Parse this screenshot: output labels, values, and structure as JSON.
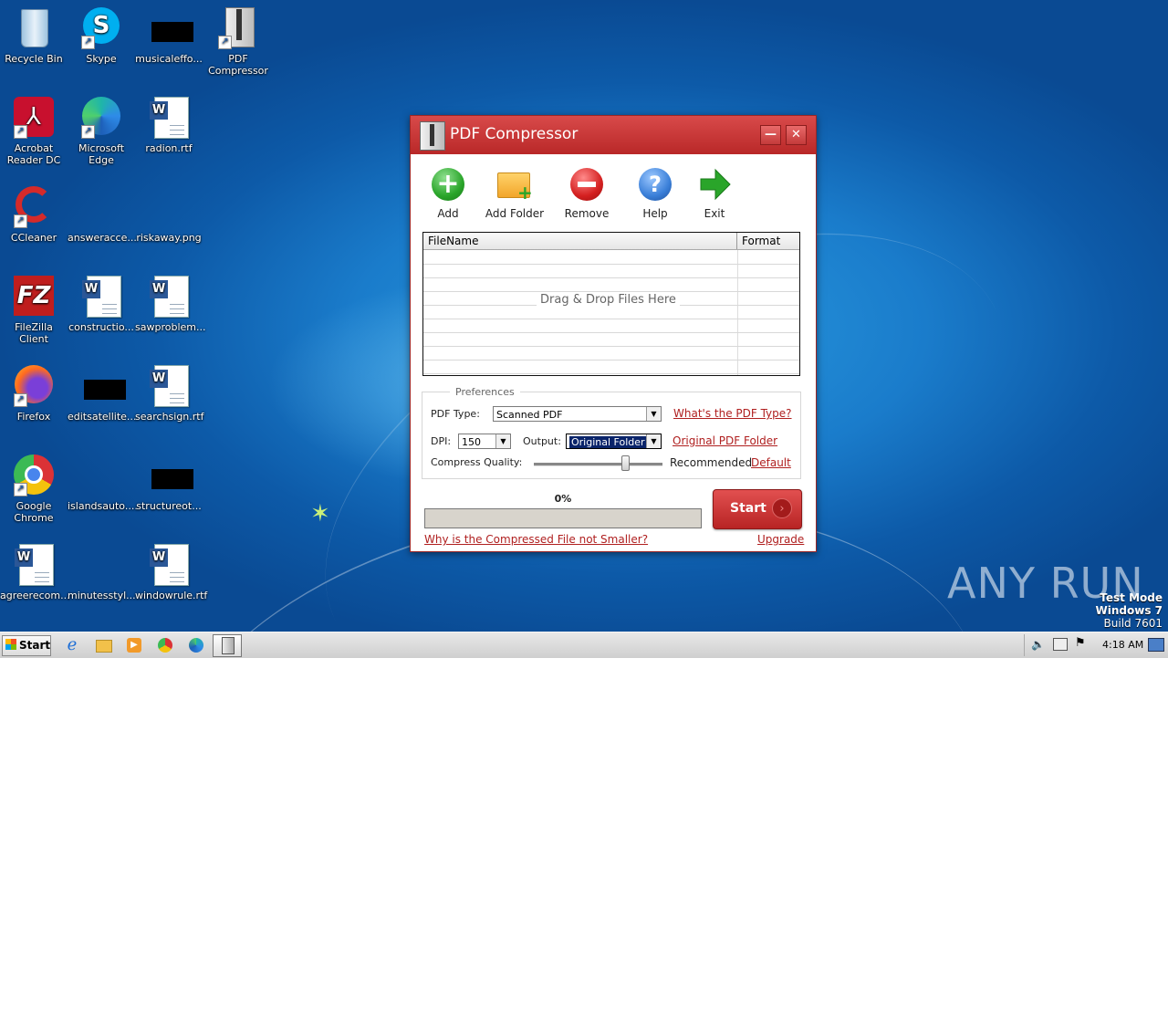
{
  "desktop": {
    "icons": [
      {
        "label": "Recycle Bin"
      },
      {
        "label": "Skype"
      },
      {
        "label": "musicaleffo..."
      },
      {
        "label": "PDF Compressor"
      },
      {
        "label": "Acrobat Reader DC"
      },
      {
        "label": "Microsoft Edge"
      },
      {
        "label": "radion.rtf"
      },
      {
        "label": "CCleaner"
      },
      {
        "label": "answeracce..."
      },
      {
        "label": "riskaway.png"
      },
      {
        "label": "FileZilla Client"
      },
      {
        "label": "constructio..."
      },
      {
        "label": "sawproblem..."
      },
      {
        "label": "Firefox"
      },
      {
        "label": "editsatellite..."
      },
      {
        "label": "searchsign.rtf"
      },
      {
        "label": "Google Chrome"
      },
      {
        "label": "islandsauto...."
      },
      {
        "label": "structureot..."
      },
      {
        "label": "agreerecom..."
      },
      {
        "label": "minutesstyl..."
      },
      {
        "label": "windowrule.rtf"
      }
    ],
    "watermark": {
      "brand": "ANY RUN",
      "line1": "Test Mode",
      "line2": "Windows 7",
      "line3": "Build 7601"
    }
  },
  "window": {
    "title": "PDF Compressor",
    "minimize": "—",
    "close": "✕",
    "toolbar": [
      {
        "label": "Add",
        "icon": "add-icon",
        "color": "#2aa52a"
      },
      {
        "label": "Add Folder",
        "icon": "add-folder-icon",
        "color": "#f2a52a"
      },
      {
        "label": "Remove",
        "icon": "remove-icon",
        "color": "#d42020"
      },
      {
        "label": "Help",
        "icon": "help-icon",
        "color": "#3a7fd8"
      },
      {
        "label": "Exit",
        "icon": "exit-arrow-icon",
        "color": "#2aa52a"
      }
    ],
    "filelist": {
      "col_filename": "FileName",
      "col_format": "Format",
      "placeholder": "Drag & Drop Files Here"
    },
    "prefs": {
      "legend": "Preferences",
      "pdf_type_label": "PDF Type:",
      "pdf_type_value": "Scanned PDF",
      "pdf_type_link": "What's the PDF Type?",
      "dpi_label": "DPI:",
      "dpi_value": "150",
      "output_label": "Output:",
      "output_value": "Original Folder",
      "output_link": "Original PDF Folder",
      "quality_label": "Compress Quality:",
      "quality_value_text": "Recommended",
      "quality_default_link": "Default",
      "quality_level": 0.73
    },
    "progress": {
      "text": "0%",
      "value": 0
    },
    "start_label": "Start",
    "why_link": "Why is the Compressed File not Smaller?",
    "upgrade_link": "Upgrade"
  },
  "taskbar": {
    "start_label": "Start",
    "clock": "4:18 AM"
  },
  "colors": {
    "accent": "#c83030",
    "titlebar": "#c83232",
    "link": "#b02020"
  }
}
